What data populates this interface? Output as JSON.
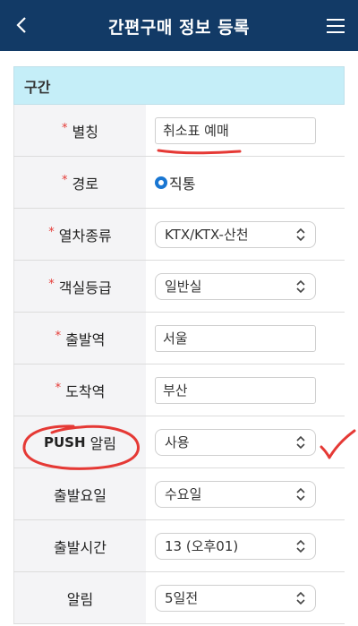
{
  "header": {
    "title": "간편구매 정보 등록",
    "back_icon": "chevron-left-icon",
    "menu_icon": "hamburger-menu-icon"
  },
  "section": {
    "title": "구간"
  },
  "fields": {
    "nickname": {
      "label": "별칭",
      "required": "*",
      "value": "취소표 예매"
    },
    "route": {
      "label": "경로",
      "required": "*",
      "option": "직통"
    },
    "train_type": {
      "label": "열차종류",
      "required": "*",
      "value": "KTX/KTX-산천"
    },
    "seat_class": {
      "label": "객실등급",
      "required": "*",
      "value": "일반실"
    },
    "departure": {
      "label": "출발역",
      "required": "*",
      "value": "서울"
    },
    "arrival": {
      "label": "도착역",
      "required": "*",
      "value": "부산"
    },
    "push": {
      "label_bold": "PUSH",
      "label_rest": " 알림",
      "value": "사용"
    },
    "weekday": {
      "label": "출발요일",
      "value": "수요일"
    },
    "time": {
      "label": "출발시간",
      "value": "13 (오후01)"
    },
    "alert": {
      "label": "알림",
      "value": "5일전"
    }
  },
  "colors": {
    "header_bg": "#123a66",
    "section_bg": "#c5eef8",
    "required": "#e53935",
    "annotation": "#e53935",
    "radio": "#1976d2"
  }
}
